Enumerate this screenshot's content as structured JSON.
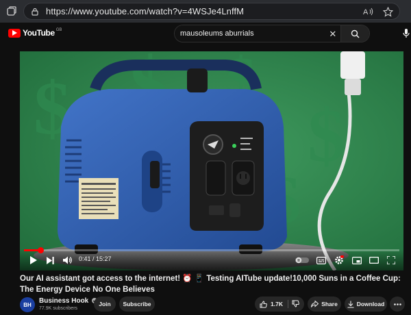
{
  "browser": {
    "url": "https://www.youtube.com/watch?v=4WSJe4LnffM",
    "url_icons": [
      "lock-icon",
      "read-aloud-icon",
      "favorite-star-icon"
    ]
  },
  "youtube": {
    "logo_text": "YouTube",
    "country_code": "GB",
    "search_value": "mausoleums aburrials"
  },
  "player": {
    "time_display": "0:41 / 15:27",
    "progress_fraction": 0.044,
    "controls": [
      "play-icon",
      "next-icon",
      "volume-icon",
      "autoplay-toggle",
      "subtitles-icon",
      "settings-icon",
      "miniplayer-icon",
      "theater-icon",
      "fullscreen-icon"
    ]
  },
  "video": {
    "title": "Our AI assistant got access to the internet! ⏰ 📱 Testing AITube update!10,000 Suns in a Coffee Cup: The Energy Device No One Believes"
  },
  "channel": {
    "name": "Business Hook",
    "subscribers": "77.9K subscribers",
    "avatar_text": "BH",
    "join_label": "Join",
    "subscribe_label": "Subscribe"
  },
  "actions": {
    "likes": "1.7K",
    "share_label": "Share",
    "download_label": "Download"
  },
  "colors": {
    "accent": "#ff0000",
    "background": "#0f0f0f",
    "video_bg": "#2c7d4a",
    "generator_blue": "#2f5fb0"
  }
}
